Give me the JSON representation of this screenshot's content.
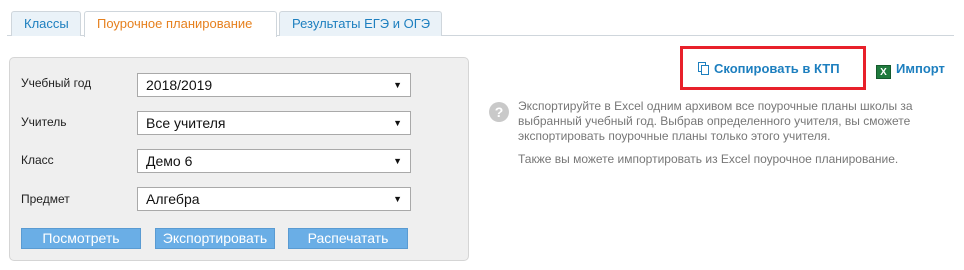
{
  "tabs": [
    {
      "label": "Классы",
      "active": false
    },
    {
      "label": "Поурочное планирование",
      "active": true
    },
    {
      "label": "Результаты ЕГЭ и ОГЭ",
      "active": false
    }
  ],
  "filters": {
    "year": {
      "label": "Учебный год",
      "value": "2018/2019"
    },
    "teacher": {
      "label": "Учитель",
      "value": "Все учителя"
    },
    "class": {
      "label": "Класс",
      "value": "Демо 6"
    },
    "subject": {
      "label": "Предмет",
      "value": "Алгебра"
    }
  },
  "buttons": {
    "view": "Посмотреть",
    "export": "Экспортировать",
    "print": "Распечатать"
  },
  "actions": {
    "copy_label": "Скопировать в КТП",
    "import_label": "Импорт",
    "excel_glyph": "X"
  },
  "help": {
    "icon_glyph": "?",
    "p1": "Экспортируйте в Excel одним архивом все поурочные планы школы за выбранный учебный год. Выбрав определенного учителя, вы сможете экспортировать поурочные планы только этого учителя.",
    "p2": "Также вы можете импортировать из Excel поурочное планирование."
  },
  "colors": {
    "accent": "#1d7fbf",
    "active_tab": "#e6801e",
    "highlight": "#e8202a",
    "button": "#6aaee6"
  }
}
